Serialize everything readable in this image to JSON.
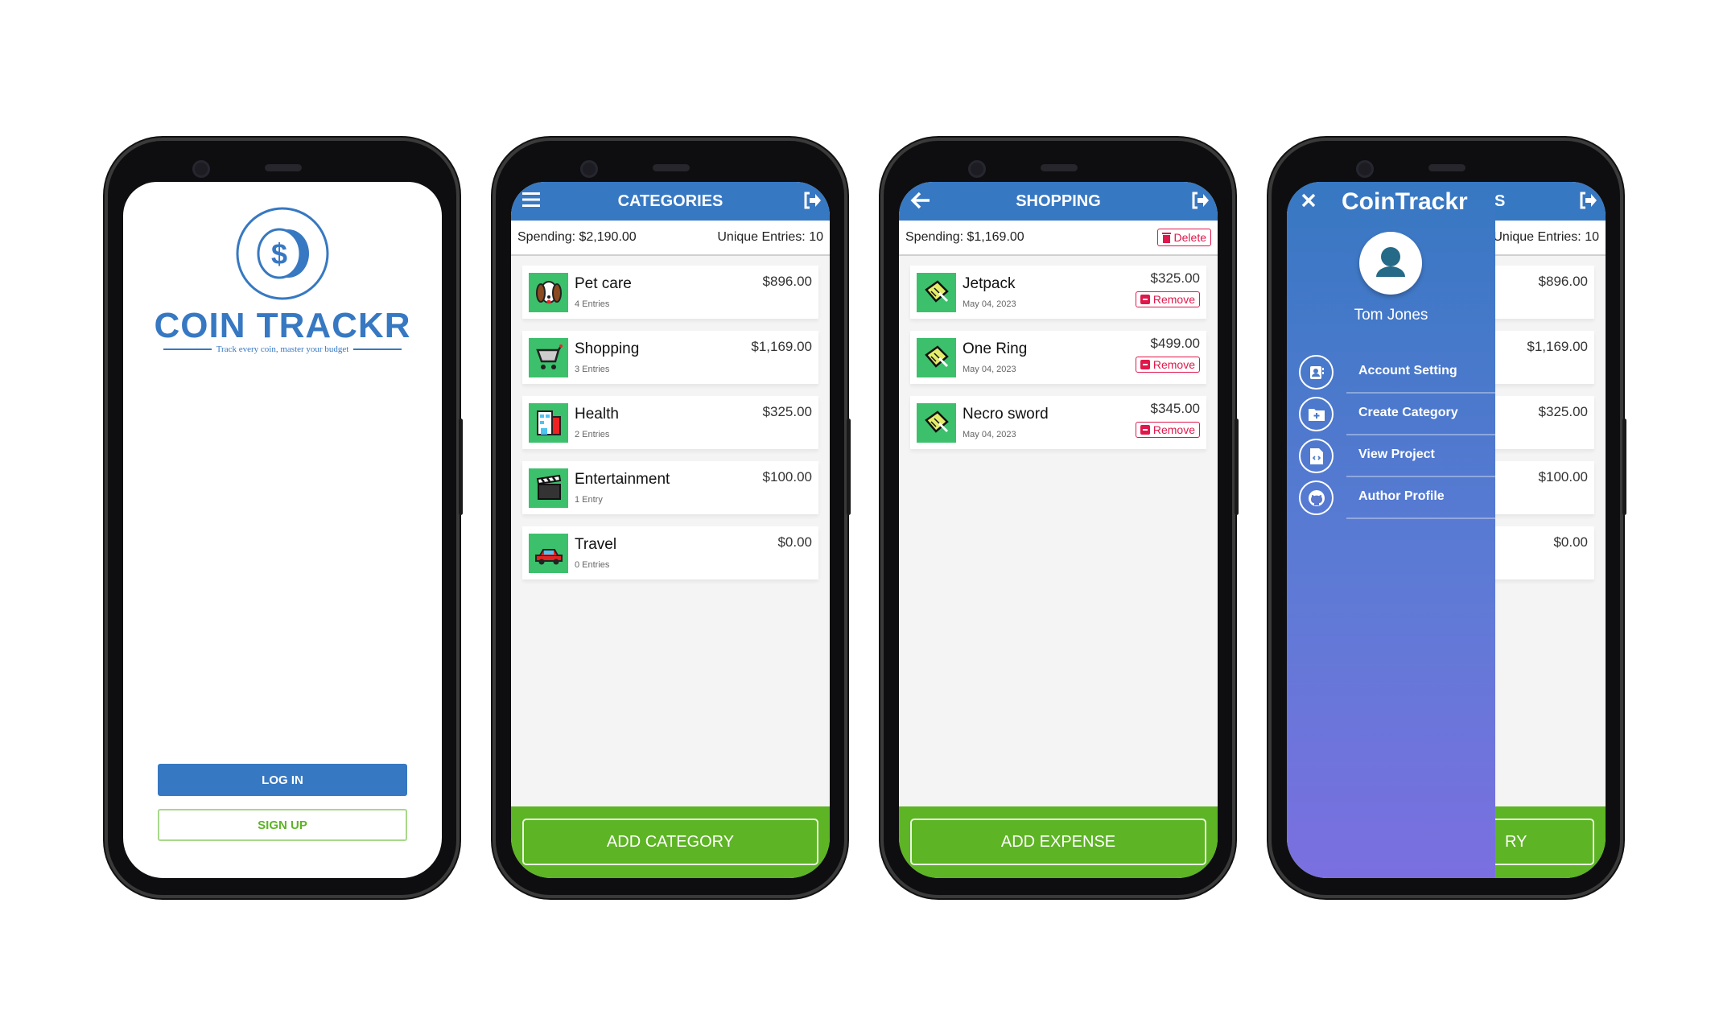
{
  "colors": {
    "primary": "#3778c2",
    "success": "#5db424",
    "category_icon_bg": "#3cc06c",
    "danger": "#e0174b"
  },
  "login": {
    "logo_title": "COIN TRACKR",
    "logo_tagline": "Track every coin, master your budget",
    "login_label": "LOG IN",
    "signup_label": "SIGN UP"
  },
  "categories": {
    "title": "CATEGORIES",
    "spending": "Spending: $2,190.00",
    "unique_entries": "Unique Entries: 10",
    "items": [
      {
        "name": "Pet care",
        "entries": "4 Entries",
        "amount": "$896.00",
        "icon": "dog-icon"
      },
      {
        "name": "Shopping",
        "entries": "3 Entries",
        "amount": "$1,169.00",
        "icon": "shopping-cart-icon"
      },
      {
        "name": "Health",
        "entries": "2 Entries",
        "amount": "$325.00",
        "icon": "hospital-icon"
      },
      {
        "name": "Entertainment",
        "entries": "1 Entry",
        "amount": "$100.00",
        "icon": "clapperboard-icon"
      },
      {
        "name": "Travel",
        "entries": "0 Entries",
        "amount": "$0.00",
        "icon": "car-icon"
      }
    ],
    "add_label": "ADD CATEGORY"
  },
  "shopping": {
    "title": "SHOPPING",
    "spending": "Spending: $1,169.00",
    "delete_label": "Delete",
    "remove_label": "Remove",
    "items": [
      {
        "name": "Jetpack",
        "date": "May 04, 2023",
        "amount": "$325.00"
      },
      {
        "name": "One Ring",
        "date": "May 04, 2023",
        "amount": "$499.00"
      },
      {
        "name": "Necro sword",
        "date": "May 04, 2023",
        "amount": "$345.00"
      }
    ],
    "add_label": "ADD EXPENSE"
  },
  "drawer": {
    "brand": "CoinTrackr",
    "user_name": "Tom Jones",
    "items": [
      {
        "label": "Account Setting",
        "icon": "contact-book-icon"
      },
      {
        "label": "Create Category",
        "icon": "folder-plus-icon"
      },
      {
        "label": "View Project",
        "icon": "code-file-icon"
      },
      {
        "label": "Author Profile",
        "icon": "github-icon"
      }
    ],
    "background_header_partial": "S",
    "background_footer_partial": "RY"
  }
}
